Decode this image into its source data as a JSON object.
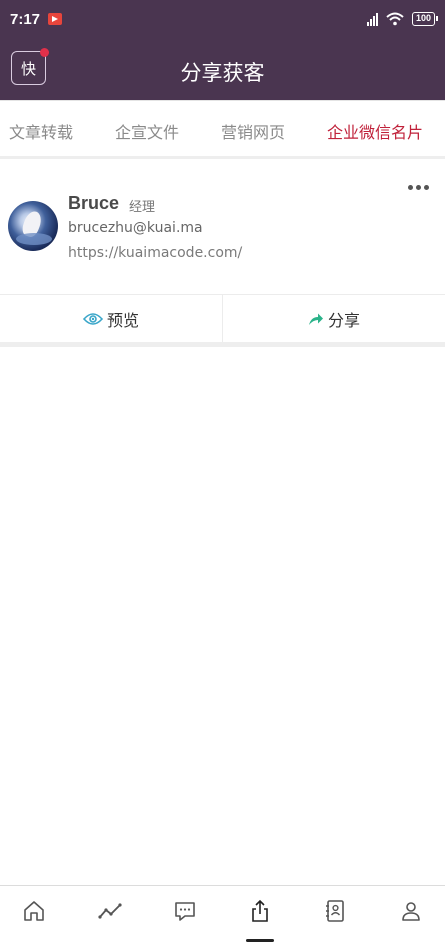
{
  "status_bar": {
    "time": "7:17",
    "battery": "100"
  },
  "app_bar": {
    "logo_text": "快",
    "title": "分享获客"
  },
  "tabs": [
    {
      "label": "文章转载",
      "active": false
    },
    {
      "label": "企宣文件",
      "active": false
    },
    {
      "label": "营销网页",
      "active": false
    },
    {
      "label": "企业微信名片",
      "active": true
    }
  ],
  "card": {
    "name": "Bruce",
    "role": "经理",
    "email": "brucezhu@kuai.ma",
    "url": "https://kuaimacode.com/",
    "preview_label": "预览",
    "share_label": "分享"
  },
  "bottom_nav": [
    {
      "icon": "home-icon",
      "active": false
    },
    {
      "icon": "trend-chart-icon",
      "active": false
    },
    {
      "icon": "message-icon",
      "active": false
    },
    {
      "icon": "share-upload-icon",
      "active": true
    },
    {
      "icon": "contacts-book-icon",
      "active": false
    },
    {
      "icon": "profile-icon",
      "active": false
    }
  ],
  "colors": {
    "header": "#4a3550",
    "active_tab": "#c0213a",
    "preview_icon": "#3aa6c9",
    "share_icon": "#2bb38a"
  }
}
